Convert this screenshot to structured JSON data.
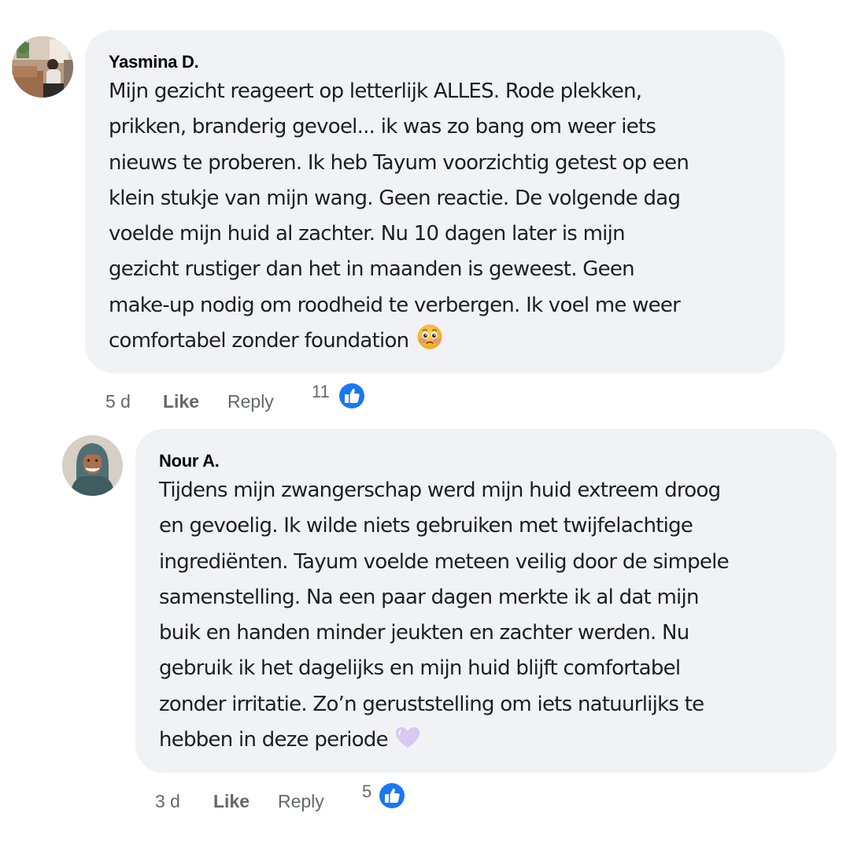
{
  "comments": [
    {
      "author": "Yasmina D.",
      "lines": [
        "Mijn gezicht reageert op letterlijk ALLES. Rode plekken,",
        "prikken, branderig gevoel... ik was zo bang om weer iets",
        "nieuws te proberen. Ik heb Tayum voorzichtig getest op een",
        "klein stukje van mijn wang. Geen reactie. De volgende dag",
        "voelde mijn huid al zachter. Nu 10 dagen later is mijn",
        "gezicht rustiger dan het in maanden is geweest. Geen",
        "make-up nodig om roodheid te verbergen. Ik voel me weer",
        "comfortabel zonder foundation"
      ],
      "emoji": "face-holding-back-tears-icon",
      "time": "5 d",
      "like_label": "Like",
      "reply_label": "Reply",
      "reaction_count": "11",
      "reaction_color": "#1877f2"
    },
    {
      "author": "Nour A.",
      "lines": [
        "Tijdens mijn zwangerschap werd mijn huid extreem droog",
        "en gevoelig. Ik wilde niets gebruiken met twijfelachtige",
        "ingrediënten. Tayum voelde meteen veilig door de simpele",
        "samenstelling. Na een paar dagen merkte ik al dat mijn",
        "buik en handen minder jeukten en zachter werden. Nu",
        "gebruik ik het dagelijks en mijn huid blijft comfortabel",
        "zonder irritatie. Zo’n geruststelling om iets natuurlijks te",
        "hebben in deze periode"
      ],
      "emoji": "purple-heart-icon",
      "time": "3 d",
      "like_label": "Like",
      "reply_label": "Reply",
      "reaction_count": "5",
      "reaction_color": "#1877f2"
    }
  ]
}
